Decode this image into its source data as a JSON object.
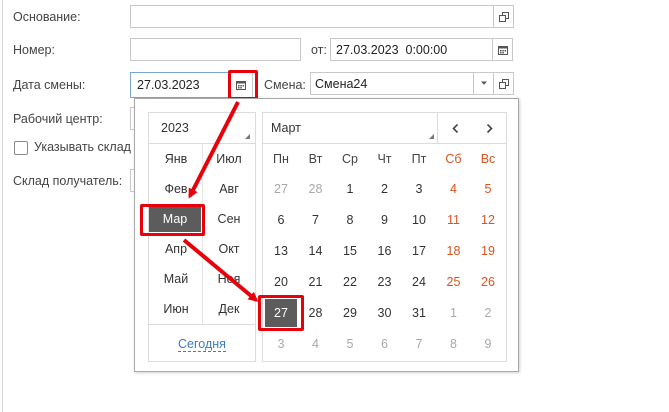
{
  "form": {
    "basis_label": "Основание:",
    "number_label": "Номер:",
    "from_label": "от:",
    "from_value": "27.03.2023  0:00:00",
    "shift_date_label": "Дата смены:",
    "shift_date_value": "27.03.2023",
    "shift_label": "Смена:",
    "shift_value": "Смена24",
    "work_center_label": "Рабочий центр:",
    "specify_warehouse_label": "Указывать склад",
    "recipient_warehouse_label": "Склад получатель:"
  },
  "calendar": {
    "year": "2023",
    "month_title": "Март",
    "months": [
      "Янв",
      "Июл",
      "Фев",
      "Авг",
      "Мар",
      "Сен",
      "Апр",
      "Окт",
      "Май",
      "Ноя",
      "Июн",
      "Дек"
    ],
    "selected_month": "Мар",
    "weekdays": [
      "Пн",
      "Вт",
      "Ср",
      "Чт",
      "Пт",
      "Сб",
      "Вс"
    ],
    "weeks": [
      [
        "27",
        "28",
        "1",
        "2",
        "3",
        "4",
        "5"
      ],
      [
        "6",
        "7",
        "8",
        "9",
        "10",
        "11",
        "12"
      ],
      [
        "13",
        "14",
        "15",
        "16",
        "17",
        "18",
        "19"
      ],
      [
        "20",
        "21",
        "22",
        "23",
        "24",
        "25",
        "26"
      ],
      [
        "27",
        "28",
        "29",
        "30",
        "31",
        "1",
        "2"
      ],
      [
        "3",
        "4",
        "5",
        "6",
        "7",
        "8",
        "9"
      ]
    ],
    "selected_day": "27",
    "today_label": "Сегодня",
    "colors": {
      "weekend": "#d9541e",
      "selected": "#5c5c5c",
      "highlight": "#e8000b",
      "link": "#3a7dc4"
    }
  },
  "icons": [
    "open-icon",
    "calendar-icon",
    "dropdown-icon",
    "prev-month-icon",
    "next-month-icon",
    "checkbox-icon"
  ]
}
